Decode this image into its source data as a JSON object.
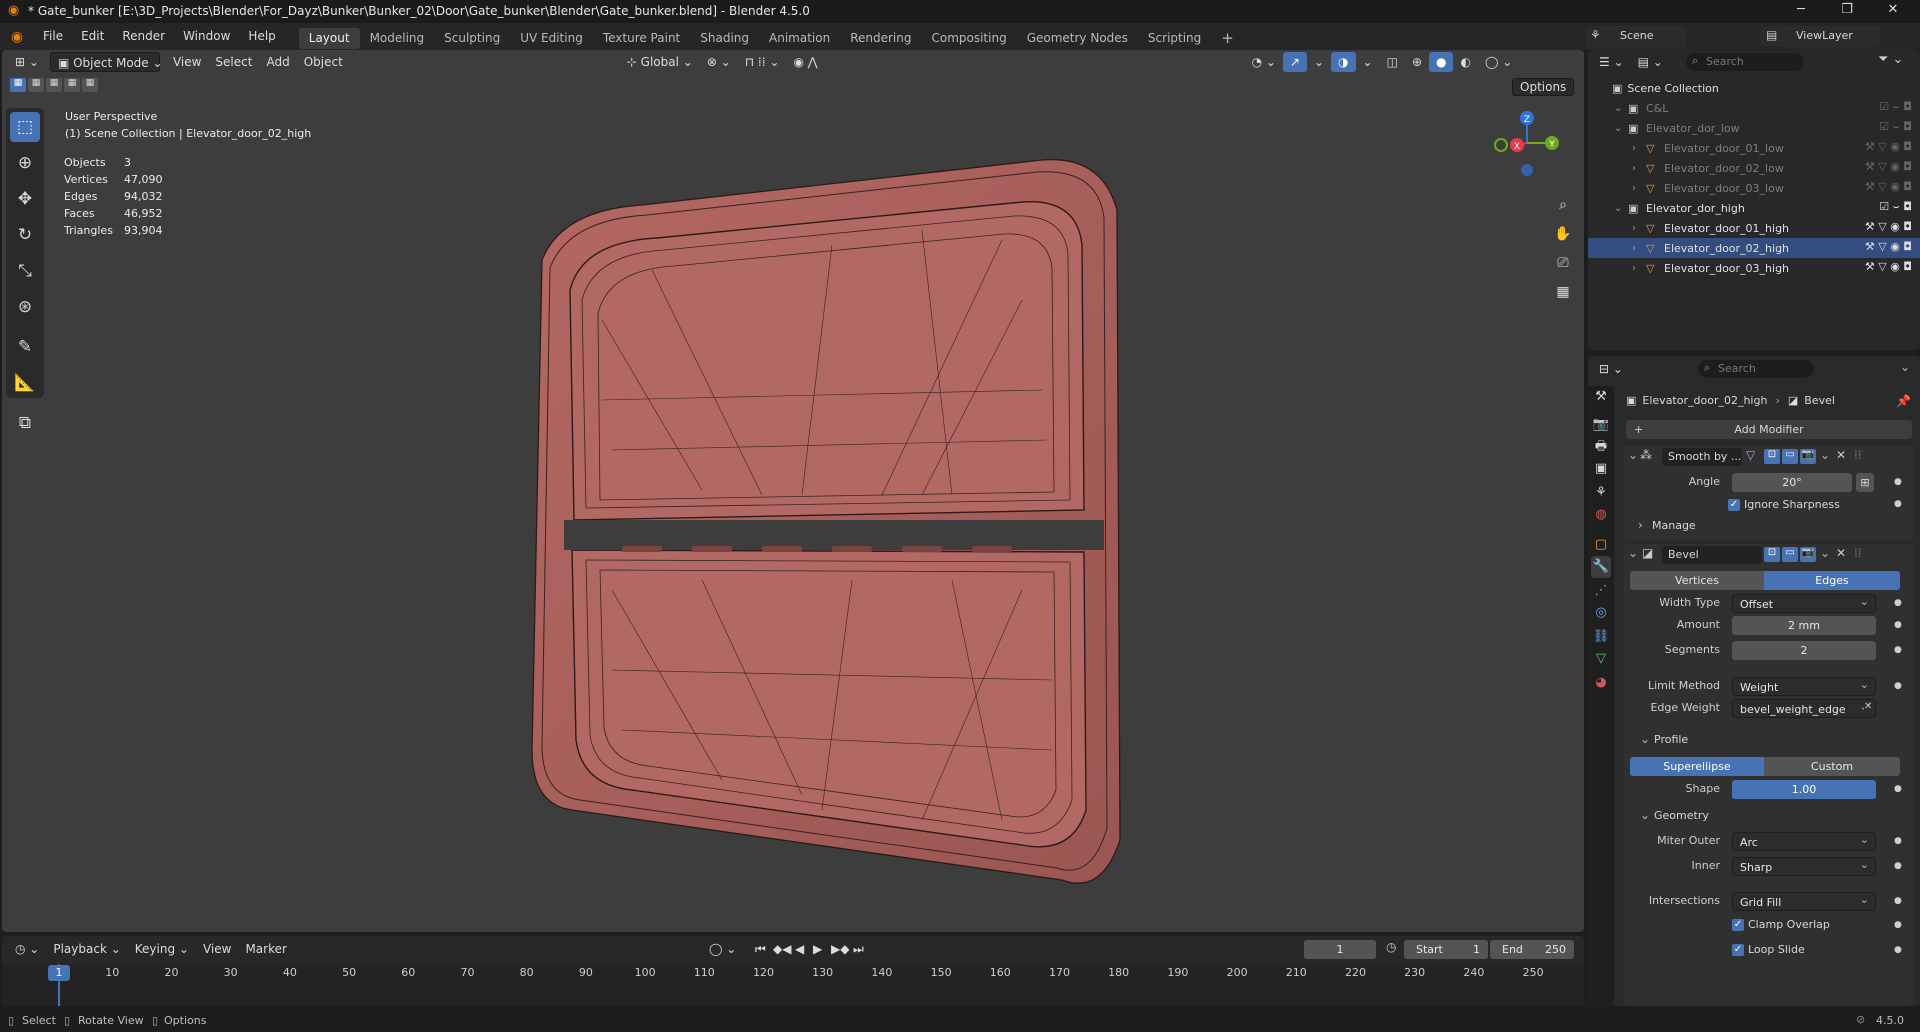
{
  "window": {
    "title": "* Gate_bunker [E:\\3D_Projects\\Blender\\For_Dayz\\Bunker\\Bunker_02\\Door\\Gate_bunker\\Blender\\Gate_bunker.blend] - Blender 4.5.0",
    "minimize": "─",
    "maximize": "❐",
    "close": "✕"
  },
  "menubar": {
    "menus": [
      "File",
      "Edit",
      "Render",
      "Window",
      "Help"
    ],
    "workspaces": [
      "Layout",
      "Modeling",
      "Sculpting",
      "UV Editing",
      "Texture Paint",
      "Shading",
      "Animation",
      "Rendering",
      "Compositing",
      "Geometry Nodes",
      "Scripting"
    ],
    "add_workspace": "+",
    "scene_label": "Scene",
    "viewlayer_label": "ViewLayer"
  },
  "viewport": {
    "mode": "Object Mode",
    "menus": [
      "View",
      "Select",
      "Add",
      "Object"
    ],
    "orientation": "Global",
    "options_label": "Options",
    "view_name": "User Perspective",
    "collection_path": "(1) Scene Collection | Elevator_door_02_high",
    "stats": [
      {
        "label": "Objects",
        "value": "3"
      },
      {
        "label": "Vertices",
        "value": "47,090"
      },
      {
        "label": "Edges",
        "value": "94,032"
      },
      {
        "label": "Faces",
        "value": "46,952"
      },
      {
        "label": "Triangles",
        "value": "93,904"
      }
    ],
    "gizmo": {
      "x": "X",
      "y": "Y",
      "z": "Z"
    },
    "mesh_color": "#a9605d"
  },
  "outliner": {
    "search_placeholder": "Search",
    "root": "Scene Collection",
    "rows": [
      {
        "name": "C&L",
        "level": 1,
        "dim": true,
        "type": "collection"
      },
      {
        "name": "Elevator_dor_low",
        "level": 1,
        "dim": true,
        "type": "collection"
      },
      {
        "name": "Elevator_door_01_low",
        "level": 2,
        "dim": true,
        "type": "mesh"
      },
      {
        "name": "Elevator_door_02_low",
        "level": 2,
        "dim": true,
        "type": "mesh"
      },
      {
        "name": "Elevator_door_03_low",
        "level": 2,
        "dim": true,
        "type": "mesh"
      },
      {
        "name": "Elevator_dor_high",
        "level": 1,
        "dim": false,
        "type": "collection"
      },
      {
        "name": "Elevator_door_01_high",
        "level": 2,
        "dim": false,
        "type": "mesh"
      },
      {
        "name": "Elevator_door_02_high",
        "level": 2,
        "dim": false,
        "type": "mesh",
        "selected": true
      },
      {
        "name": "Elevator_door_03_high",
        "level": 2,
        "dim": false,
        "type": "mesh"
      }
    ]
  },
  "properties": {
    "search_placeholder": "Search",
    "object_name": "Elevator_door_02_high",
    "modifier_crumb": "Bevel",
    "add_modifier": "Add Modifier",
    "smooth": {
      "name": "Smooth by ...",
      "angle_label": "Angle",
      "angle_value": "20°",
      "ignore_sharpness": "Ignore Sharpness",
      "manage": "Manage"
    },
    "bevel": {
      "name": "Bevel",
      "tab_vertices": "Vertices",
      "tab_edges": "Edges",
      "width_type_label": "Width Type",
      "width_type": "Offset",
      "amount_label": "Amount",
      "amount": "2 mm",
      "segments_label": "Segments",
      "segments": "2",
      "limit_method_label": "Limit Method",
      "limit_method": "Weight",
      "edge_weight_label": "Edge Weight",
      "edge_weight": "bevel_weight_edge",
      "profile_label": "Profile",
      "superellipse": "Superellipse",
      "custom": "Custom",
      "shape_label": "Shape",
      "shape": "1.00",
      "geometry_label": "Geometry",
      "miter_outer_label": "Miter Outer",
      "miter_outer": "Arc",
      "inner_label": "Inner",
      "inner": "Sharp",
      "intersections_label": "Intersections",
      "intersections": "Grid Fill",
      "clamp_overlap": "Clamp Overlap",
      "loop_slide": "Loop Slide"
    }
  },
  "timeline": {
    "menus": [
      "Playback",
      "Keying",
      "View",
      "Marker"
    ],
    "current_frame": "1",
    "start_label": "Start",
    "start": "1",
    "end_label": "End",
    "end": "250",
    "ticks": [
      "1",
      "10",
      "20",
      "30",
      "40",
      "50",
      "60",
      "70",
      "80",
      "90",
      "100",
      "110",
      "120",
      "130",
      "140",
      "150",
      "160",
      "170",
      "180",
      "190",
      "200",
      "210",
      "220",
      "230",
      "240",
      "250"
    ]
  },
  "statusbar": {
    "select": "Select",
    "rotate": "Rotate View",
    "options": "Options",
    "version": "4.5.0"
  }
}
